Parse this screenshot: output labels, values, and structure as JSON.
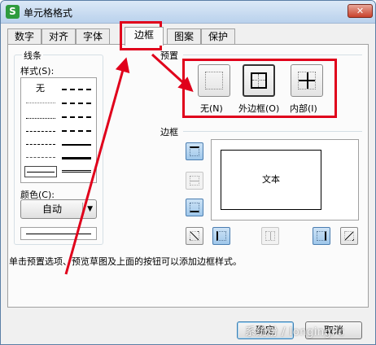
{
  "window": {
    "title": "单元格格式",
    "app_icon_letter": "S",
    "close_glyph": "✕"
  },
  "tabs": [
    {
      "label": "数字"
    },
    {
      "label": "对齐"
    },
    {
      "label": "字体"
    },
    {
      "label": "边框",
      "active": true
    },
    {
      "label": "图案"
    },
    {
      "label": "保护"
    }
  ],
  "line_section": {
    "title": "线条",
    "style_label": "样式(S):",
    "none_label": "无",
    "color_label": "颜色(C):",
    "color_value": "自动",
    "color_dropdown_icon": "triangle-down-icon"
  },
  "presets": {
    "title": "预置",
    "items": [
      {
        "label": "无(N)"
      },
      {
        "label": "外边框(O)"
      },
      {
        "label": "内部(I)"
      }
    ]
  },
  "border": {
    "title": "边框",
    "preview_text": "文本"
  },
  "hint": "单击预置选项、预览草图及上面的按钮可以添加边框样式。",
  "buttons": {
    "ok": "确定",
    "cancel": "取消"
  },
  "watermark": "系统粉 / longingPc",
  "annotation_color": "#e0001b",
  "accent": "#2e9b3e"
}
